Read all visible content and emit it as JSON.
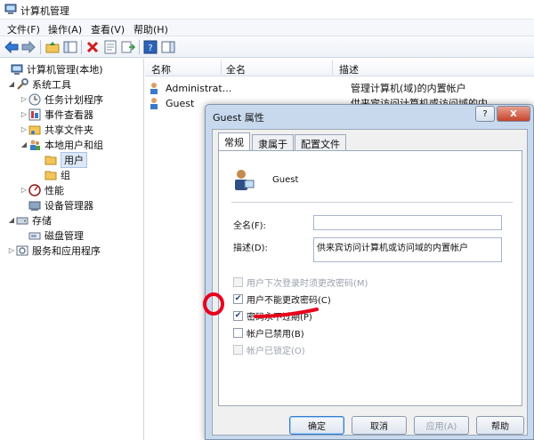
{
  "window": {
    "title": "计算机管理"
  },
  "menu": {
    "items": [
      "文件(F)",
      "操作(A)",
      "查看(V)",
      "帮助(H)"
    ]
  },
  "tree": {
    "root": "计算机管理(本地)",
    "system_tools": "系统工具",
    "task_scheduler": "任务计划程序",
    "event_viewer": "事件查看器",
    "shared_folders": "共享文件夹",
    "local_users": "本地用户和组",
    "users": "用户",
    "groups": "组",
    "performance": "性能",
    "device_manager": "设备管理器",
    "storage": "存储",
    "disk_management": "磁盘管理",
    "services": "服务和应用程序"
  },
  "list": {
    "columns": [
      "名称",
      "全名",
      "描述"
    ],
    "rows": [
      {
        "name": "Administrat...",
        "fullname": "",
        "desc": "管理计算机(域)的内置帐户"
      },
      {
        "name": "Guest",
        "fullname": "",
        "desc": "供来宾访问计算机或访问域的内..."
      }
    ]
  },
  "dialog": {
    "title": "Guest 属性",
    "help_label": "?",
    "close_label": "X",
    "tabs": [
      "常规",
      "隶属于",
      "配置文件"
    ],
    "username": "Guest",
    "fullname_label": "全名(F):",
    "fullname_value": "",
    "desc_label": "描述(D):",
    "desc_value": "供来宾访问计算机或访问域的内置帐户",
    "checkboxes": [
      {
        "label": "用户下次登录时须更改密码(M)",
        "checked": false,
        "disabled": true
      },
      {
        "label": "用户不能更改密码(C)",
        "checked": true,
        "disabled": false
      },
      {
        "label": "密码永不过期(P)",
        "checked": true,
        "disabled": false
      },
      {
        "label": "帐户已禁用(B)",
        "checked": false,
        "disabled": false
      },
      {
        "label": "帐户已锁定(O)",
        "checked": false,
        "disabled": true
      }
    ],
    "buttons": {
      "ok": "确定",
      "cancel": "取消",
      "apply": "应用(A)",
      "help": "帮助"
    }
  },
  "colors": {
    "annotation": "#e8001c",
    "selection": "#dce8f7"
  }
}
